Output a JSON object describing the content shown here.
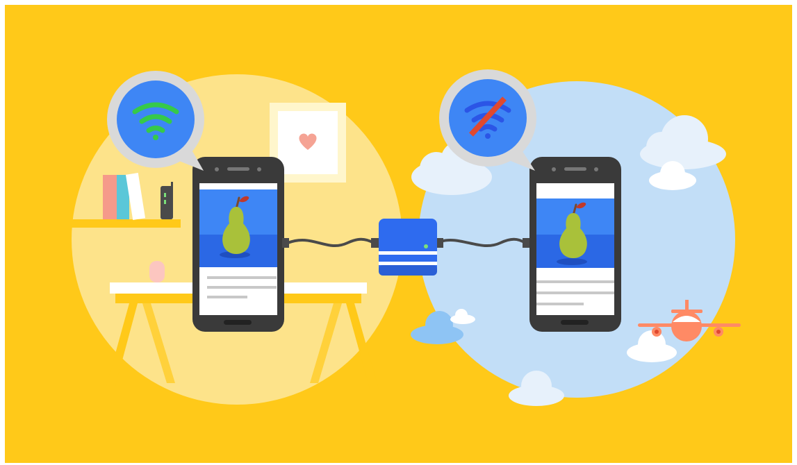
{
  "scene": {
    "background_color": "#FFC919",
    "left_scene": {
      "status": "wifi-online",
      "circle_color": "#FDE38A",
      "status_icon": "wifi-icon",
      "status_icon_color": "#36C94A"
    },
    "right_scene": {
      "status": "wifi-offline",
      "circle_color": "#C2DEF7",
      "status_icon": "wifi-off-icon",
      "status_icon_color": "#2B55E6",
      "strike_color": "#E0492F"
    },
    "phone": {
      "body_color": "#3A3A3A",
      "screen_color": "#FFFFFF",
      "image_sky": "#3E86F5",
      "image_water": "#2B68E5",
      "fruit": "pear-icon",
      "fruit_color": "#A9C13A"
    },
    "sync_device": {
      "icon": "server-icon",
      "color": "#2E6BEF",
      "led_color": "#7BE07A"
    },
    "airplane_color": "#FF8A65",
    "cloud_color": "#E7F1FB"
  }
}
